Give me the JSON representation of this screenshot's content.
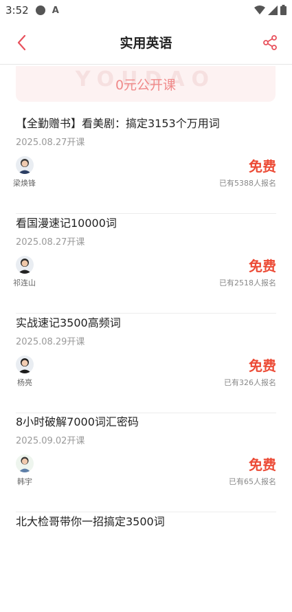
{
  "status_bar": {
    "time": "3:52",
    "indicator_text": "A"
  },
  "header": {
    "title": "实用英语",
    "back_icon": "chevron-left-icon",
    "share_icon": "share-icon"
  },
  "banner": {
    "text": "0元公开课",
    "watermark": "YOUDAO"
  },
  "courses": [
    {
      "title": "【全勤赠书】看美剧：搞定3153个万用词",
      "date": "2025.08.27开课",
      "teacher": "梁焕锋",
      "price": "免费",
      "enrolled": "已有5388人报名"
    },
    {
      "title": "看国漫速记10000词",
      "date": "2025.08.27开课",
      "teacher": "祁连山",
      "price": "免费",
      "enrolled": "已有2518人报名"
    },
    {
      "title": "实战速记3500高频词",
      "date": "2025.08.29开课",
      "teacher": "杨亮",
      "price": "免费",
      "enrolled": "已有326人报名"
    },
    {
      "title": "8小时破解7000词汇密码",
      "date": "2025.09.02开课",
      "teacher": "韩宇",
      "price": "免费",
      "enrolled": "已有65人报名"
    },
    {
      "title": "北大检哥带你一招搞定3500词",
      "date": "",
      "teacher": "",
      "price": "",
      "enrolled": ""
    }
  ],
  "colors": {
    "accent": "#ec4b36",
    "back_icon": "#e8505b"
  }
}
